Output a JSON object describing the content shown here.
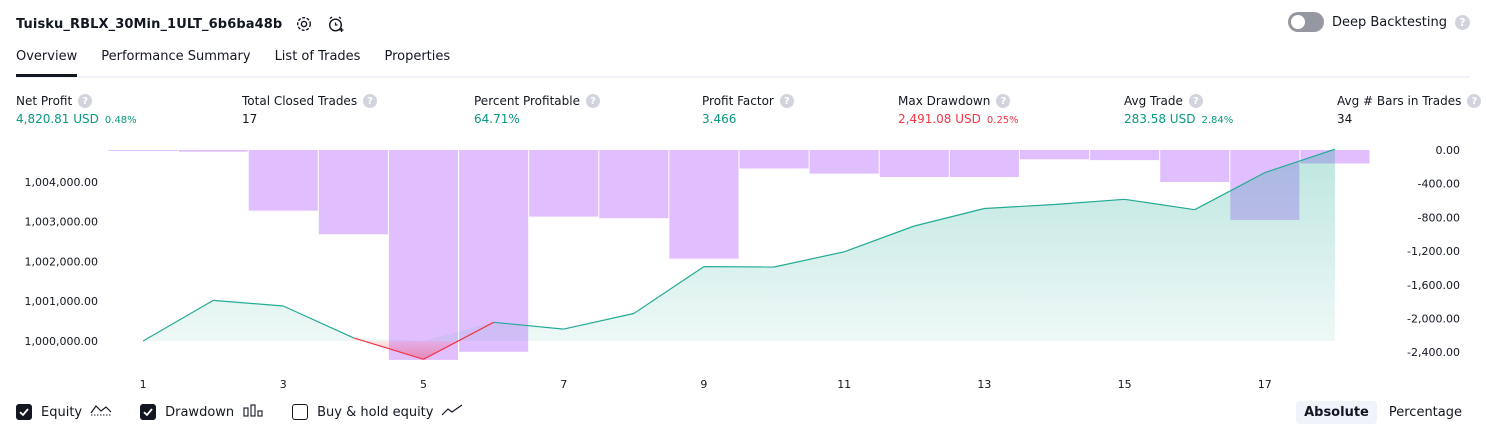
{
  "header": {
    "strategy_name": "Tuisku_RBLX_30Min_1ULT_6b6ba48b",
    "settings_icon": "gear-icon",
    "alert_icon": "alarm-clock-plus-icon",
    "deep_backtesting_label": "Deep Backtesting",
    "deep_backtesting_enabled": false,
    "help_glyph": "?"
  },
  "tabs": [
    {
      "label": "Overview",
      "active": true
    },
    {
      "label": "Performance Summary",
      "active": false
    },
    {
      "label": "List of Trades",
      "active": false
    },
    {
      "label": "Properties",
      "active": false
    }
  ],
  "metrics": [
    {
      "label": "Net Profit",
      "value": "4,820.81 USD",
      "pct": "0.48%",
      "color": "#089981"
    },
    {
      "label": "Total Closed Trades",
      "value": "17",
      "pct": "",
      "color": "#131722"
    },
    {
      "label": "Percent Profitable",
      "value": "64.71%",
      "pct": "",
      "color": "#089981"
    },
    {
      "label": "Profit Factor",
      "value": "3.466",
      "pct": "",
      "color": "#089981"
    },
    {
      "label": "Max Drawdown",
      "value": "2,491.08 USD",
      "pct": "0.25%",
      "color": "#f23645"
    },
    {
      "label": "Avg Trade",
      "value": "283.58 USD",
      "pct": "2.84%",
      "color": "#089981"
    },
    {
      "label": "Avg # Bars in Trades",
      "value": "34",
      "pct": "",
      "color": "#131722"
    }
  ],
  "chart_data": {
    "type": "area",
    "x": [
      1,
      2,
      3,
      4,
      5,
      6,
      7,
      8,
      9,
      10,
      11,
      12,
      13,
      14,
      15,
      16,
      17,
      18
    ],
    "x_ticks": [
      1,
      3,
      5,
      7,
      9,
      11,
      13,
      15,
      17
    ],
    "left_axis": {
      "ticks": [
        "1,000,000.00",
        "1,001,000.00",
        "1,002,000.00",
        "1,003,000.00",
        "1,004,000.00"
      ],
      "tick_values": [
        1000000,
        1001000,
        1002000,
        1003000,
        1004000
      ]
    },
    "right_axis": {
      "ticks": [
        "0.00",
        "-400.00",
        "-800.00",
        "-1,200.00",
        "-1,600.00",
        "-2,000.00",
        "-2,400.00"
      ],
      "tick_values": [
        0,
        -400,
        -800,
        -1200,
        -1600,
        -2000,
        -2400
      ]
    },
    "series": [
      {
        "name": "Equity",
        "axis": "left",
        "color": "#22ab94",
        "negative_color": "#f23645",
        "values": [
          1000000,
          1001020,
          1000880,
          1000080,
          999540,
          1000470,
          1000300,
          1000690,
          1001870,
          1001860,
          1002240,
          1002890,
          1003330,
          1003430,
          1003560,
          1003300,
          1004230,
          1004820
        ]
      },
      {
        "name": "Drawdown",
        "axis": "right",
        "color": "#e1bfff",
        "values": [
          0,
          -20,
          -720,
          -1000,
          -2491,
          -2395,
          -790,
          -810,
          -1290,
          -220,
          -280,
          -320,
          -320,
          -110,
          -120,
          -380,
          -830,
          -160
        ]
      }
    ]
  },
  "legend": [
    {
      "label": "Equity",
      "checked": true,
      "icon": "equity-line-icon"
    },
    {
      "label": "Drawdown",
      "checked": true,
      "icon": "drawdown-bars-icon"
    },
    {
      "label": "Buy & hold equity",
      "checked": false,
      "icon": "buy-hold-line-icon"
    }
  ],
  "mode": {
    "absolute_label": "Absolute",
    "percentage_label": "Percentage",
    "active": "Absolute"
  }
}
